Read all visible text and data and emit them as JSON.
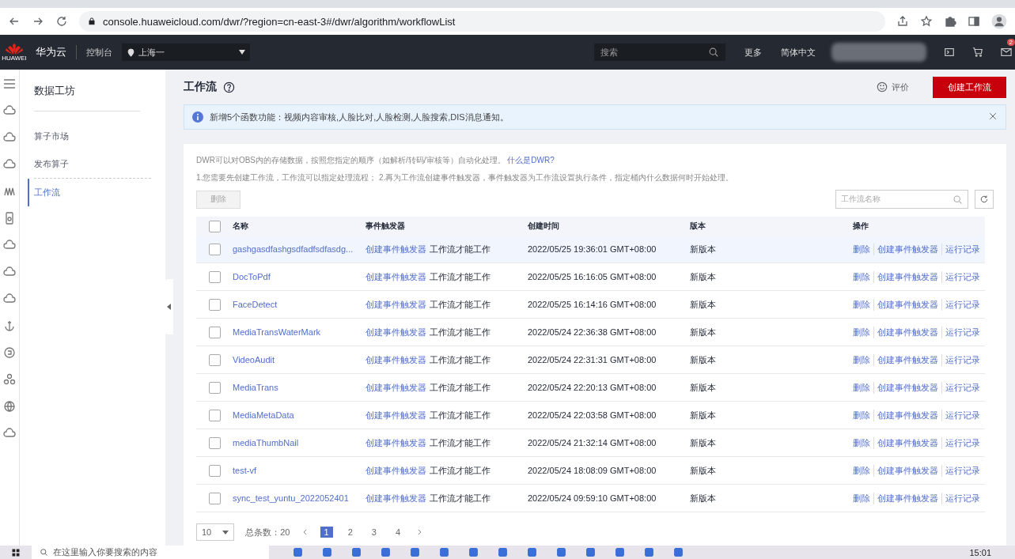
{
  "browser": {
    "url": "console.huaweicloud.com/dwr/?region=cn-east-3#/dwr/algorithm/workflowList"
  },
  "topnav": {
    "brand": "华为云",
    "brand_small": "HUAWEI",
    "console": "控制台",
    "region": "上海一",
    "search_placeholder": "搜索",
    "more": "更多",
    "language": "简体中文",
    "mail_badge": "2"
  },
  "sidebar": {
    "title": "数据工坊",
    "items": [
      {
        "label": "算子市场",
        "selected": false
      },
      {
        "label": "发布算子",
        "selected": false
      },
      {
        "label": "工作流",
        "selected": true
      }
    ]
  },
  "page": {
    "title": "工作流",
    "rate": "评价",
    "create_button": "创建工作流",
    "notice": "新增5个函数功能：视频内容审核,人脸比对,人脸检测,人脸搜索,DIS消息通知。",
    "intro": "DWR可以对OBS内的存储数据，按照您指定的顺序（如解析/转码/审核等）自动化处理。",
    "intro_link": "什么是DWR?",
    "steps": "1.您需要先创建工作流，工作流可以指定处理流程； 2.再为工作流创建事件触发器，事件触发器为工作流设置执行条件，指定桶内什么数据何时开始处理。",
    "delete_button": {
      "label": "删除",
      "disabled": true
    },
    "search_placeholder": "工作流名称"
  },
  "table": {
    "select_all_checked": false,
    "columns": [
      "名称",
      "事件触发器",
      "创建时间",
      "版本",
      "操作"
    ],
    "rows": [
      {
        "name": "gashgasdfashgsdfadfsdfasdg...",
        "trigger_link": "创建事件触发器",
        "trigger_note": "工作流才能工作",
        "created": "2022/05/25 19:36:01 GMT+08:00",
        "version": "新版本",
        "actions": [
          "删除",
          "创建事件触发器",
          "运行记录"
        ],
        "checked": false,
        "highlighted": true
      },
      {
        "name": "DocToPdf",
        "trigger_link": "创建事件触发器",
        "trigger_note": "工作流才能工作",
        "created": "2022/05/25 16:16:05 GMT+08:00",
        "version": "新版本",
        "actions": [
          "删除",
          "创建事件触发器",
          "运行记录"
        ],
        "checked": false,
        "highlighted": false
      },
      {
        "name": "FaceDetect",
        "trigger_link": "创建事件触发器",
        "trigger_note": "工作流才能工作",
        "created": "2022/05/25 16:14:16 GMT+08:00",
        "version": "新版本",
        "actions": [
          "删除",
          "创建事件触发器",
          "运行记录"
        ],
        "checked": false,
        "highlighted": false
      },
      {
        "name": "MediaTransWaterMark",
        "trigger_link": "创建事件触发器",
        "trigger_note": "工作流才能工作",
        "created": "2022/05/24 22:36:38 GMT+08:00",
        "version": "新版本",
        "actions": [
          "删除",
          "创建事件触发器",
          "运行记录"
        ],
        "checked": false,
        "highlighted": false
      },
      {
        "name": "VideoAudit",
        "trigger_link": "创建事件触发器",
        "trigger_note": "工作流才能工作",
        "created": "2022/05/24 22:31:31 GMT+08:00",
        "version": "新版本",
        "actions": [
          "删除",
          "创建事件触发器",
          "运行记录"
        ],
        "checked": false,
        "highlighted": false
      },
      {
        "name": "MediaTrans",
        "trigger_link": "创建事件触发器",
        "trigger_note": "工作流才能工作",
        "created": "2022/05/24 22:20:13 GMT+08:00",
        "version": "新版本",
        "actions": [
          "删除",
          "创建事件触发器",
          "运行记录"
        ],
        "checked": false,
        "highlighted": false
      },
      {
        "name": "MediaMetaData",
        "trigger_link": "创建事件触发器",
        "trigger_note": "工作流才能工作",
        "created": "2022/05/24 22:03:58 GMT+08:00",
        "version": "新版本",
        "actions": [
          "删除",
          "创建事件触发器",
          "运行记录"
        ],
        "checked": false,
        "highlighted": false
      },
      {
        "name": "mediaThumbNail",
        "trigger_link": "创建事件触发器",
        "trigger_note": "工作流才能工作",
        "created": "2022/05/24 21:32:14 GMT+08:00",
        "version": "新版本",
        "actions": [
          "删除",
          "创建事件触发器",
          "运行记录"
        ],
        "checked": false,
        "highlighted": false
      },
      {
        "name": "test-vf",
        "trigger_link": "创建事件触发器",
        "trigger_note": "工作流才能工作",
        "created": "2022/05/24 18:08:09 GMT+08:00",
        "version": "新版本",
        "actions": [
          "删除",
          "创建事件触发器",
          "运行记录"
        ],
        "checked": false,
        "highlighted": false
      },
      {
        "name": "sync_test_yuntu_2022052401",
        "trigger_link": "创建事件触发器",
        "trigger_note": "工作流才能工作",
        "created": "2022/05/24 09:59:10 GMT+08:00",
        "version": "新版本",
        "actions": [
          "删除",
          "创建事件触发器",
          "运行记录"
        ],
        "checked": false,
        "highlighted": false
      }
    ]
  },
  "pagination": {
    "page_size": "10",
    "total": "总条数：20",
    "pages": [
      {
        "label": "1",
        "selected": true
      },
      {
        "label": "2",
        "selected": false
      },
      {
        "label": "3",
        "selected": false
      },
      {
        "label": "4",
        "selected": false
      }
    ]
  },
  "taskbar": {
    "search_placeholder": "在这里输入你要搜索的内容",
    "time": "15:01"
  }
}
